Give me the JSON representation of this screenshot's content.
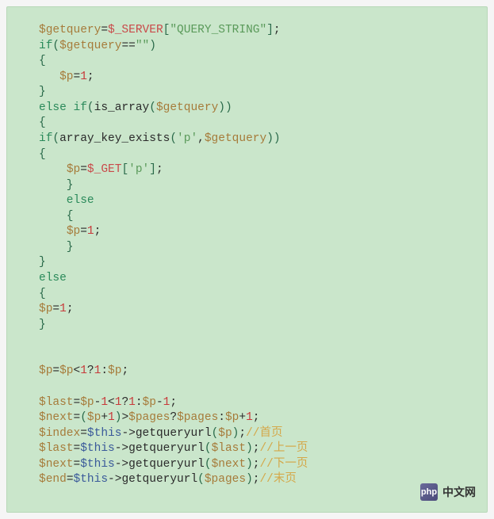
{
  "code": {
    "l1_var": "$getquery",
    "l1_eq": "=",
    "l1_global": "$_SERVER",
    "l1_open": "[",
    "l1_str": "\"QUERY_STRING\"",
    "l1_close": "]",
    "l1_semi": ";",
    "l2_if": "if",
    "l2_open": "(",
    "l2_var": "$getquery",
    "l2_eqeq": "==",
    "l2_str": "\"\"",
    "l2_close": ")",
    "l3_brace_open": "{",
    "l4_indent": "   ",
    "l4_var": "$p",
    "l4_eq": "=",
    "l4_num": "1",
    "l4_semi": ";",
    "l5_brace_close": "}",
    "l6_else": "else ",
    "l6_if": "if",
    "l6_open": "(",
    "l6_func": "is_array",
    "l6_popen": "(",
    "l6_var": "$getquery",
    "l6_pclose": ")",
    "l6_close": ")",
    "l7_brace_open": "{",
    "l8_if": "if",
    "l8_open": "(",
    "l8_func": "array_key_exists",
    "l8_popen": "(",
    "l8_str": "'p'",
    "l8_comma": ",",
    "l8_var": "$getquery",
    "l8_pclose": ")",
    "l8_close": ")",
    "l9_brace_open": "{",
    "l10_indent": "    ",
    "l10_var": "$p",
    "l10_eq": "=",
    "l10_global": "$_GET",
    "l10_open": "[",
    "l10_str": "'p'",
    "l10_close": "]",
    "l10_semi": ";",
    "l11_brace_close": "    }",
    "l12_else": "    else",
    "l13_brace_open": "    {",
    "l14_indent": "    ",
    "l14_var": "$p",
    "l14_eq": "=",
    "l14_num": "1",
    "l14_semi": ";",
    "l15_brace_close": "    }",
    "l16_brace_close": "}",
    "l17_else": "else",
    "l18_brace_open": "{",
    "l19_var": "$p",
    "l19_eq": "=",
    "l19_num": "1",
    "l19_semi": ";",
    "l20_brace_close": "}",
    "l22_var": "$p",
    "l22_eq": "=",
    "l22_var2": "$p",
    "l22_lt": "<",
    "l22_num1": "1",
    "l22_q": "?",
    "l22_num2": "1",
    "l22_colon": ":",
    "l22_var3": "$p",
    "l22_semi": ";",
    "l24_var": "$last",
    "l24_eq": "=",
    "l24_var2": "$p",
    "l24_minus": "-",
    "l24_num1": "1",
    "l24_lt": "<",
    "l24_num2": "1",
    "l24_q": "?",
    "l24_num3": "1",
    "l24_colon": ":",
    "l24_var3": "$p",
    "l24_minus2": "-",
    "l24_num4": "1",
    "l24_semi": ";",
    "l25_var": "$next",
    "l25_eq": "=",
    "l25_open": "(",
    "l25_var2": "$p",
    "l25_plus": "+",
    "l25_num1": "1",
    "l25_close": ")",
    "l25_gt": ">",
    "l25_var3": "$pages",
    "l25_q": "?",
    "l25_var4": "$pages",
    "l25_colon": ":",
    "l25_var5": "$p",
    "l25_plus2": "+",
    "l25_num2": "1",
    "l25_semi": ";",
    "l26_var": "$index",
    "l26_eq": "=",
    "l26_this": "$this",
    "l26_arrow": "->",
    "l26_method": "getqueryurl",
    "l26_open": "(",
    "l26_arg": "$p",
    "l26_close": ")",
    "l26_semi": ";",
    "l26_comment": "//首页",
    "l27_var": "$last",
    "l27_eq": "=",
    "l27_this": "$this",
    "l27_arrow": "->",
    "l27_method": "getqueryurl",
    "l27_open": "(",
    "l27_arg": "$last",
    "l27_close": ")",
    "l27_semi": ";",
    "l27_comment": "//上一页",
    "l28_var": "$next",
    "l28_eq": "=",
    "l28_this": "$this",
    "l28_arrow": "->",
    "l28_method": "getqueryurl",
    "l28_open": "(",
    "l28_arg": "$next",
    "l28_close": ")",
    "l28_semi": ";",
    "l28_comment": "//下一页",
    "l29_var": "$end",
    "l29_eq": "=",
    "l29_this": "$this",
    "l29_arrow": "->",
    "l29_method": "getqueryurl",
    "l29_open": "(",
    "l29_arg": "$pages",
    "l29_close": ")",
    "l29_semi": ";",
    "l29_comment": "//末页"
  },
  "watermark": {
    "logo": "php",
    "text": "中文网"
  }
}
